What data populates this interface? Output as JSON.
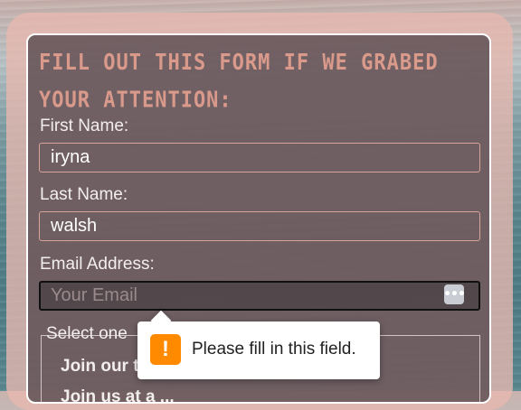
{
  "form": {
    "heading": "Fill out this form if we grabed your attention:",
    "first_name": {
      "label": "First Name:",
      "value": "iryna"
    },
    "last_name": {
      "label": "Last Name:",
      "value": "walsh"
    },
    "email": {
      "label": "Email Address:",
      "value": "",
      "placeholder": "Your Email"
    },
    "fieldset": {
      "legend": "Select one",
      "options": [
        "Join our t",
        "Join us at a ..."
      ]
    }
  },
  "validation_tooltip": {
    "icon": "warning-icon",
    "message": "Please fill in this field."
  },
  "colors": {
    "heading": "#d99a8c",
    "input_border": "#d9a397",
    "warning": "#ff8a00"
  }
}
